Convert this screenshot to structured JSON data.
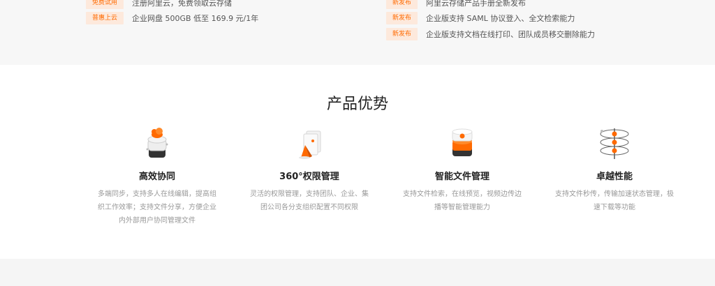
{
  "promos": {
    "left": [
      {
        "tag": "免费试用",
        "text": "注册阿里云，免费领取云存储"
      },
      {
        "tag": "普惠上云",
        "text": "企业网盘 500GB 低至 169.9 元/1年"
      }
    ],
    "right": [
      {
        "tag": "新发布",
        "text": "阿里云存储产品手册全新发布"
      },
      {
        "tag": "新发布",
        "text": "企业版支持 SAML 协议登入、全文检索能力"
      },
      {
        "tag": "新发布",
        "text": "企业版支持文档在线打印、团队成员移交删除能力"
      }
    ]
  },
  "advantages": {
    "title": "产品优势",
    "items": [
      {
        "icon": "cloud-collab-icon",
        "title": "高效协同",
        "desc": "多端同步，支持多人在线编辑，提高组织工作效率；支持文件分享，方便企业内外部用户协同管理文件"
      },
      {
        "icon": "permission-icon",
        "title": "360°权限管理",
        "desc": "灵活的权限管理，支持团队、企业、集团公司各分支组织配置不同权限"
      },
      {
        "icon": "file-manage-icon",
        "title": "智能文件管理",
        "desc": "支持文件检索，在线预览，视频边传边播等智能管理能力"
      },
      {
        "icon": "performance-icon",
        "title": "卓越性能",
        "desc": "支持文件秒传，传输加速状态管理，极速下载等功能"
      }
    ]
  },
  "colors": {
    "accent": "#ff6a00",
    "tag_bg": "#fde9dc"
  }
}
